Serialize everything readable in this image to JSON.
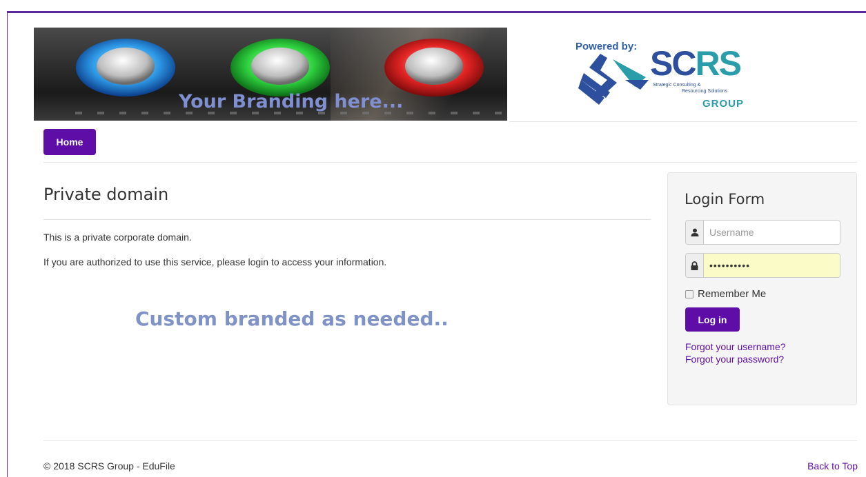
{
  "header": {
    "banner_text": "Your Branding here...",
    "powered_label": "Powered by:",
    "logo": {
      "name_left": "SC",
      "name_right": "RS",
      "subtitle_line1": "Strategic Consulting &",
      "subtitle_line2": "Resourcing Solutions",
      "group": "GROUP"
    }
  },
  "nav": {
    "home_label": "Home"
  },
  "main": {
    "title": "Private domain",
    "paragraph1": "This is a private corporate domain.",
    "paragraph2": "If you are authorized to use this service, please login to access your information.",
    "custom_text": "Custom branded as needed.."
  },
  "login": {
    "title": "Login Form",
    "username_placeholder": "Username",
    "username_value": "",
    "password_value": "••••••••••",
    "remember_label": "Remember Me",
    "remember_checked": false,
    "login_button": "Log in",
    "forgot_username": "Forgot your username?",
    "forgot_password": "Forgot your password?"
  },
  "footer": {
    "copyright": "© 2018 SCRS Group - EduFile",
    "back_to_top": "Back to Top"
  },
  "colors": {
    "accent": "#5e0da6",
    "border": "#5c2a9d",
    "custom_text": "#8093c6",
    "logo_blue": "#2d4f9e",
    "logo_teal": "#2a9dab"
  }
}
